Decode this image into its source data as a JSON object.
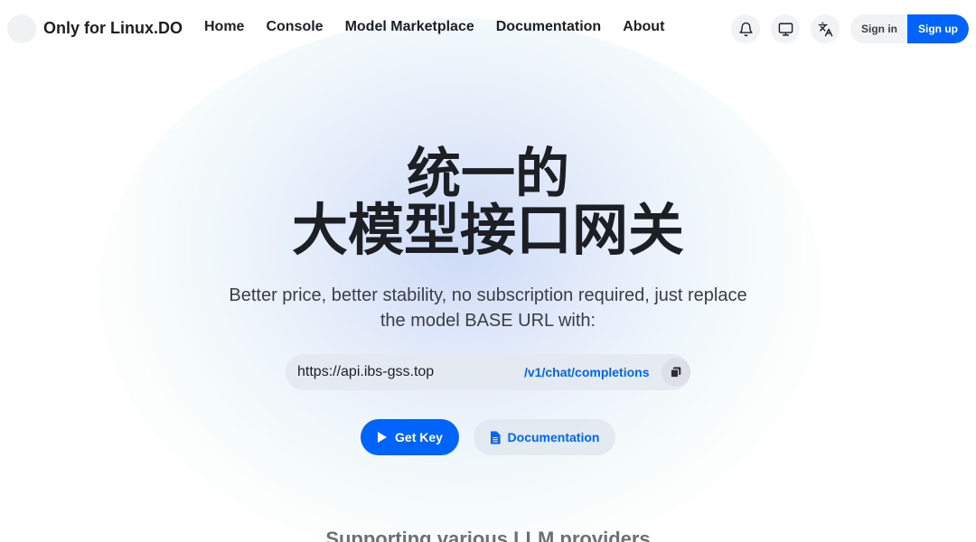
{
  "brand": {
    "name": "Only for Linux.DO"
  },
  "nav": {
    "links": [
      "Home",
      "Console",
      "Model Marketplace",
      "Documentation",
      "About"
    ]
  },
  "header_icons": [
    "bell-icon",
    "monitor-icon",
    "translate-icon"
  ],
  "auth": {
    "sign_in": "Sign in",
    "sign_up": "Sign up"
  },
  "hero": {
    "title_line1": "统一的",
    "title_line2": "大模型接口网关",
    "subtitle": "Better price, better stability, no subscription required, just replace the model BASE URL with:",
    "base_url": "https://api.ibs-gss.top",
    "endpoint": "/v1/chat/completions",
    "primary_button": "Get Key",
    "secondary_button": "Documentation",
    "providers_heading": "Supporting various LLM providers"
  },
  "colors": {
    "accent": "#0064fa",
    "text": "#1c1f23",
    "muted": "#3a3e44"
  }
}
